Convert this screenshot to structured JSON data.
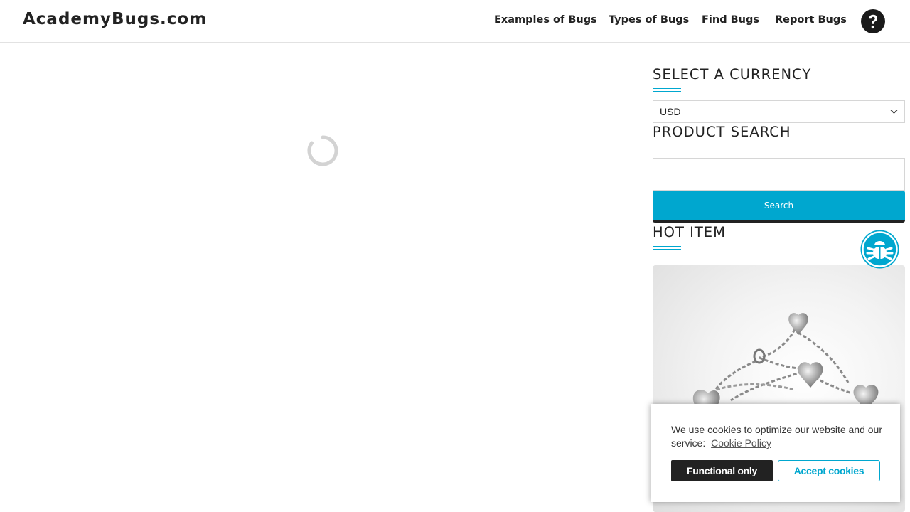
{
  "header": {
    "logo": "AcademyBugs.com",
    "nav": [
      "Examples of Bugs",
      "Types of Bugs",
      "Find Bugs",
      "Report Bugs"
    ]
  },
  "sidebar": {
    "currency": {
      "title": "SELECT A CURRENCY",
      "selected": "USD"
    },
    "search": {
      "title": "PRODUCT SEARCH",
      "value": "",
      "button_label": "Search"
    },
    "hot_item": {
      "title": "HOT ITEM"
    }
  },
  "cookie_banner": {
    "text": "We use cookies to optimize our website and our service:",
    "link": "Cookie Policy",
    "functional_label": "Functional only",
    "accept_label": "Accept cookies"
  },
  "icons": {
    "help": "question-circle-icon",
    "spinner": "loading-spinner-icon",
    "bug_button": "bug-icon",
    "dropdown": "chevron-down-icon"
  },
  "colors": {
    "accent": "#00a7cf",
    "dark": "#222222"
  }
}
